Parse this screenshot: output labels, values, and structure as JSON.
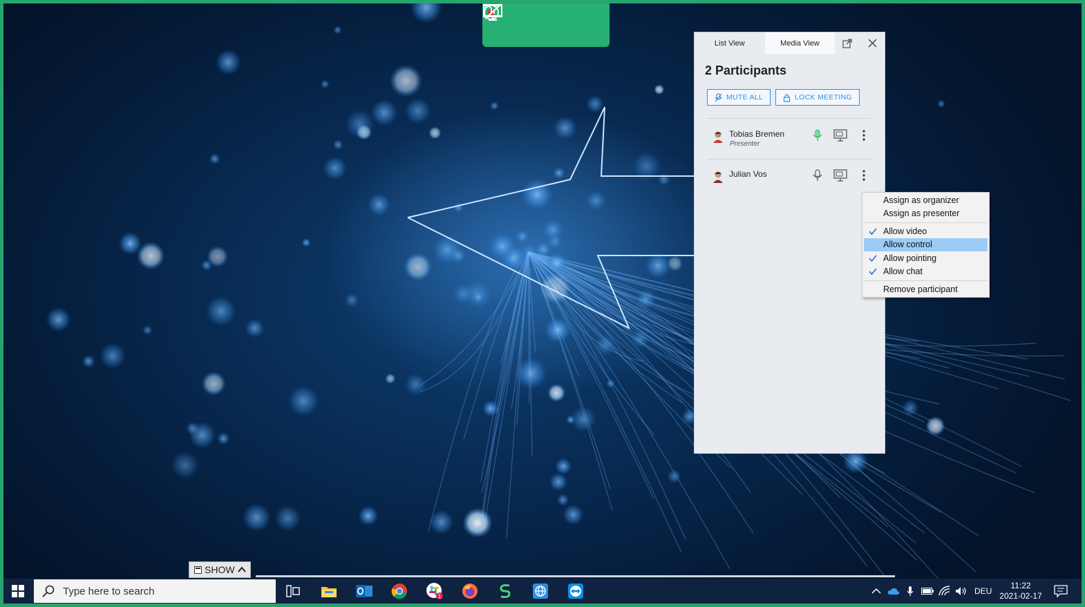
{
  "toolbar": {
    "buttons": [
      "record-icon",
      "present-screen-icon",
      "stop-sharing-icon"
    ],
    "accent": "#27b074"
  },
  "panel": {
    "tabs": [
      {
        "label": "List View",
        "active": false
      },
      {
        "label": "Media View",
        "active": true
      }
    ],
    "title": "2 Participants",
    "mute_all_label": "MUTE ALL",
    "lock_meeting_label": "LOCK MEETING",
    "participants": [
      {
        "name": "Tobias Bremen",
        "role": "Presenter",
        "mic_active": true
      },
      {
        "name": "Julian Vos",
        "role": "",
        "mic_active": false
      }
    ]
  },
  "context_menu": {
    "items": [
      {
        "label": "Assign as organizer",
        "checked": false
      },
      {
        "label": "Assign as presenter",
        "checked": false
      },
      {
        "label": "Allow video",
        "checked": true
      },
      {
        "label": "Allow control",
        "checked": false,
        "highlighted": true
      },
      {
        "label": "Allow pointing",
        "checked": true
      },
      {
        "label": "Allow chat",
        "checked": true
      },
      {
        "label": "Remove participant",
        "checked": false
      }
    ]
  },
  "show_tab": {
    "label": "SHOW"
  },
  "taskbar": {
    "search_placeholder": "Type here to search",
    "apps": [
      "task-view-icon",
      "file-explorer-icon",
      "outlook-icon",
      "chrome-icon",
      "slack-icon",
      "firefox-icon",
      "s-app-icon",
      "network-app-icon",
      "teamviewer-icon"
    ],
    "slack_badge": "1",
    "language": "DEU",
    "time": "11:22",
    "date": "2021-02-17"
  }
}
